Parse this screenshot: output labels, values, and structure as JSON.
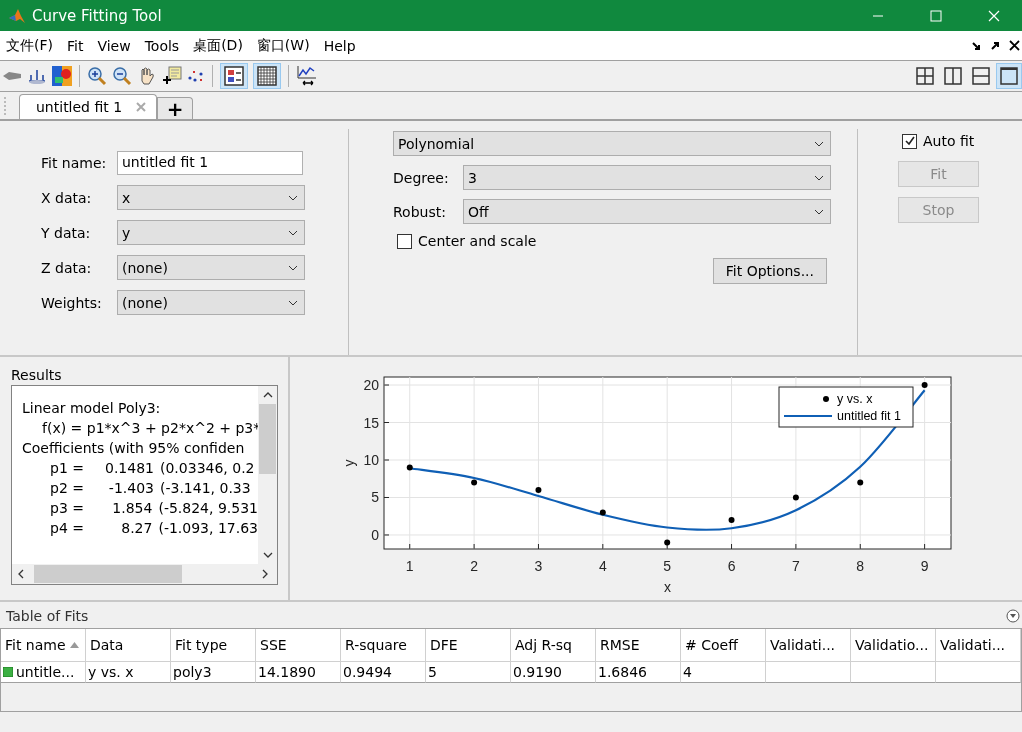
{
  "window": {
    "title": "Curve Fitting Tool"
  },
  "menu": [
    "文件(F)",
    "Fit",
    "View",
    "Tools",
    "桌面(D)",
    "窗口(W)",
    "Help"
  ],
  "toolbar": {
    "legend": {
      "selected": true
    },
    "grid": {
      "selected": true
    },
    "layouts": [
      {
        "selected": false
      },
      {
        "selected": false
      },
      {
        "selected": false
      },
      {
        "selected": true
      }
    ]
  },
  "tabs": [
    {
      "label": "untitled fit 1",
      "selected": true
    }
  ],
  "new_tab": "+",
  "fit_form": [
    {
      "label": "Fit name:",
      "kind": "text",
      "value": "untitled fit 1"
    },
    {
      "label": "X data:",
      "kind": "select",
      "value": "x"
    },
    {
      "label": "Y data:",
      "kind": "select",
      "value": "y"
    },
    {
      "label": "Z data:",
      "kind": "select",
      "value": "(none)"
    },
    {
      "label": "Weights:",
      "kind": "select",
      "value": "(none)"
    }
  ],
  "fit_type": "Polynomial",
  "fit_settings": [
    {
      "label": "Degree:",
      "value": "3"
    },
    {
      "label": "Robust:",
      "value": "Off"
    }
  ],
  "center_and_scale": {
    "label": "Center and scale",
    "checked": false
  },
  "fit_options_button": "Fit Options...",
  "auto_fit": {
    "label": "Auto fit",
    "checked": true
  },
  "actions": [
    {
      "label": "Fit",
      "disabled": true
    },
    {
      "label": "Stop",
      "disabled": true
    }
  ],
  "results": {
    "title": "Results",
    "lines": [
      {
        "kind": "heading",
        "text": "Linear model Poly3:"
      },
      {
        "kind": "formula",
        "text": "f(x) = p1*x^3 + p2*x^2 + p3*"
      },
      {
        "kind": "heading",
        "text": "Coefficients (with 95% confiden"
      },
      {
        "kind": "coef",
        "name": "p1 =",
        "value": "0.1481",
        "interval": "(0.03346, 0.2"
      },
      {
        "kind": "coef",
        "name": "p2 =",
        "value": "-1.403",
        "interval": "(-3.141, 0.33"
      },
      {
        "kind": "coef",
        "name": "p3 =",
        "value": "1.854",
        "interval": "(-5.824, 9.531"
      },
      {
        "kind": "coef",
        "name": "p4 =",
        "value": "8.27",
        "interval": "(-1.093, 17.63"
      }
    ]
  },
  "plot": {
    "chart_data": {
      "type": "line",
      "grid": true,
      "legend": "upper right",
      "xlabel": "x",
      "ylabel": "y",
      "x": [
        1,
        2,
        3,
        4,
        5,
        6,
        7,
        8,
        9
      ],
      "series": [
        {
          "name": "y vs. x",
          "type": "scatter",
          "color": "#000000",
          "values": [
            9,
            7,
            6,
            3,
            -1,
            2,
            5,
            7,
            20
          ]
        },
        {
          "name": "untitled fit 1",
          "type": "line",
          "color": "#0f5fb5",
          "values": [
            8.9,
            7.6,
            5.2,
            2.7,
            1.0,
            0.9,
            3.3,
            9.1,
            19.3
          ]
        }
      ],
      "xlim": [
        0.6,
        9.41
      ],
      "ylim": [
        -1.87,
        21.07
      ],
      "xticks": [
        1,
        2,
        3,
        4,
        5,
        6,
        7,
        8,
        9
      ],
      "yticks": [
        0,
        5,
        10,
        15,
        20
      ]
    }
  },
  "table": {
    "title": "Table of Fits",
    "columns": [
      "Fit name",
      "Data",
      "Fit type",
      "SSE",
      "R-square",
      "DFE",
      "Adj R-sq",
      "RMSE",
      "# Coeff",
      "Validati...",
      "Validatio...",
      "Validati..."
    ],
    "rows": [
      {
        "cells": [
          "untitle...",
          "y vs. x",
          "poly3",
          "14.1890",
          "0.9494",
          "5",
          "0.9190",
          "1.6846",
          "4"
        ]
      }
    ]
  }
}
